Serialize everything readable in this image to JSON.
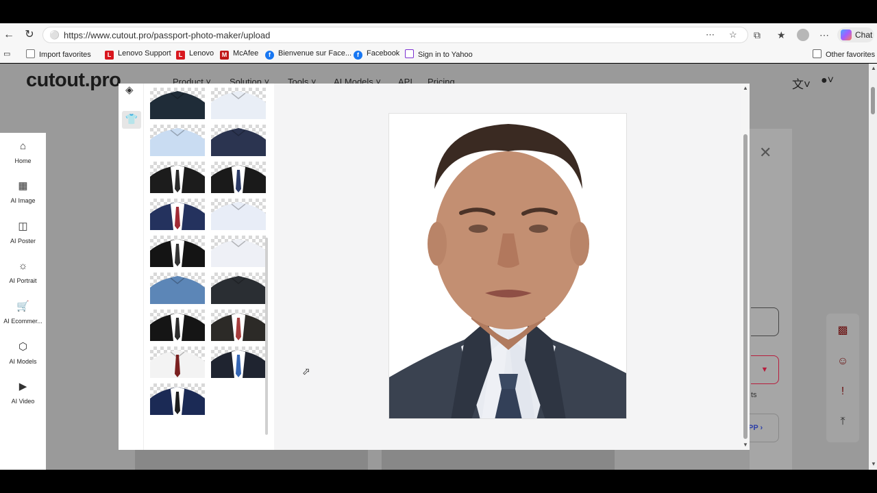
{
  "browser": {
    "url": "https://www.cutout.pro/passport-photo-maker/upload",
    "chat_label": "Chat",
    "favorites": [
      {
        "label": "Import favorites"
      },
      {
        "label": "Lenovo Support"
      },
      {
        "label": "Lenovo"
      },
      {
        "label": "McAfee"
      },
      {
        "label": "Bienvenue sur Face..."
      },
      {
        "label": "Facebook"
      },
      {
        "label": "Sign in to Yahoo"
      }
    ],
    "other_favorites": "Other favorites"
  },
  "site": {
    "logo": "cutout.pro",
    "nav": [
      "Product",
      "Solution",
      "Tools",
      "AI Models",
      "API",
      "Pricing"
    ],
    "partial_text_1": "ts",
    "partial_text_2": "PP"
  },
  "sidebar": {
    "items": [
      {
        "label": "Home",
        "icon": "home-icon"
      },
      {
        "label": "AI Image",
        "icon": "image-icon"
      },
      {
        "label": "AI Poster",
        "icon": "poster-icon"
      },
      {
        "label": "AI Portrait",
        "icon": "portrait-icon"
      },
      {
        "label": "AI Ecommer...",
        "icon": "cart-icon"
      },
      {
        "label": "AI Models",
        "icon": "cube-icon"
      },
      {
        "label": "AI Video",
        "icon": "video-icon"
      }
    ]
  },
  "modal": {
    "tools": [
      "paint-bucket-icon",
      "shirt-icon"
    ],
    "outfits": [
      {
        "shirt": "#1f2c38",
        "jacket": null,
        "tie": null
      },
      {
        "shirt": "#e9eef6",
        "jacket": null,
        "tie": null
      },
      {
        "shirt": "#c9dcf2",
        "jacket": null,
        "tie": null
      },
      {
        "shirt": "#2b3450",
        "jacket": null,
        "tie": null
      },
      {
        "shirt": "#ffffff",
        "jacket": "#1c1c1c",
        "tie": "#2a2a2a"
      },
      {
        "shirt": "#ffffff",
        "jacket": "#1a1a1a",
        "tie": "#2b3a66"
      },
      {
        "shirt": "#ffffff",
        "jacket": "#24325e",
        "tie": "#a12a35"
      },
      {
        "shirt": "#e8edf7",
        "jacket": null,
        "tie": null
      },
      {
        "shirt": "#ffffff",
        "jacket": "#141414",
        "tie": "#333333"
      },
      {
        "shirt": "#eef0f6",
        "jacket": null,
        "tie": null
      },
      {
        "shirt": "#5c86b7",
        "jacket": null,
        "tie": null
      },
      {
        "shirt": "#2a2e33",
        "jacket": null,
        "tie": null
      },
      {
        "shirt": "#ffffff",
        "jacket": "#151515",
        "tie": "#2c2c2c"
      },
      {
        "shirt": "#ffffff",
        "jacket": "#2c2a27",
        "tie": "#a63c3c"
      },
      {
        "shirt": "#f3f3f3",
        "jacket": null,
        "tie": "#7a2020"
      },
      {
        "shirt": "#ffffff",
        "jacket": "#1f2430",
        "tie": "#3566b5"
      },
      {
        "shirt": "#ffffff",
        "jacket": "#1b2a55",
        "tie": "#1d1d1d"
      }
    ]
  }
}
